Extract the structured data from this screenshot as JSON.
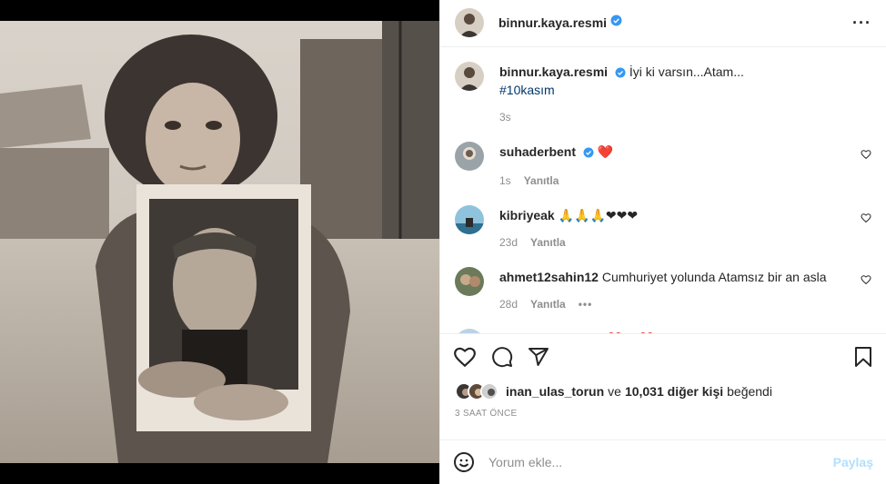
{
  "post": {
    "username": "binnur.kaya.resmi",
    "caption_username": "binnur.kaya.resmi",
    "caption_text": "İyi ki varsın...Atam...",
    "hashtag": "#10kasım",
    "caption_time": "3s"
  },
  "comments": [
    {
      "username": "suhaderbent",
      "text": "❤️",
      "time": "1s",
      "reply": "Yanıtla",
      "verified": true
    },
    {
      "username": "kibriyeak",
      "text": "🙏🙏🙏❤❤❤",
      "time": "23d",
      "reply": "Yanıtla",
      "verified": false
    },
    {
      "username": "ahmet12sahin12",
      "text": "Cumhuriyet yolunda Atamsız bir an asla",
      "time": "28d",
      "reply": "Yanıtla",
      "verified": false,
      "more": "•••"
    },
    {
      "username": "savaskurtsabriye",
      "text": "❤️🇹🇷❤️",
      "time": "",
      "reply": "",
      "verified": false
    }
  ],
  "likes": {
    "first_user": "inan_ulas_torun",
    "connector": "ve",
    "count_text": "10,031 diğer kişi",
    "suffix": "beğendi"
  },
  "timestamp": "3 SAAT ÖNCE",
  "add_comment": {
    "placeholder": "Yorum ekle...",
    "post_label": "Paylaş"
  },
  "colors": {
    "verified": "#3897f0",
    "link": "#00376b",
    "muted": "#8e8e8e",
    "post_disabled": "#b2dffc"
  },
  "icons": [
    "verified-badge-icon",
    "more-options-icon",
    "heart-icon",
    "comment-icon",
    "share-icon",
    "bookmark-icon",
    "emoji-icon"
  ]
}
